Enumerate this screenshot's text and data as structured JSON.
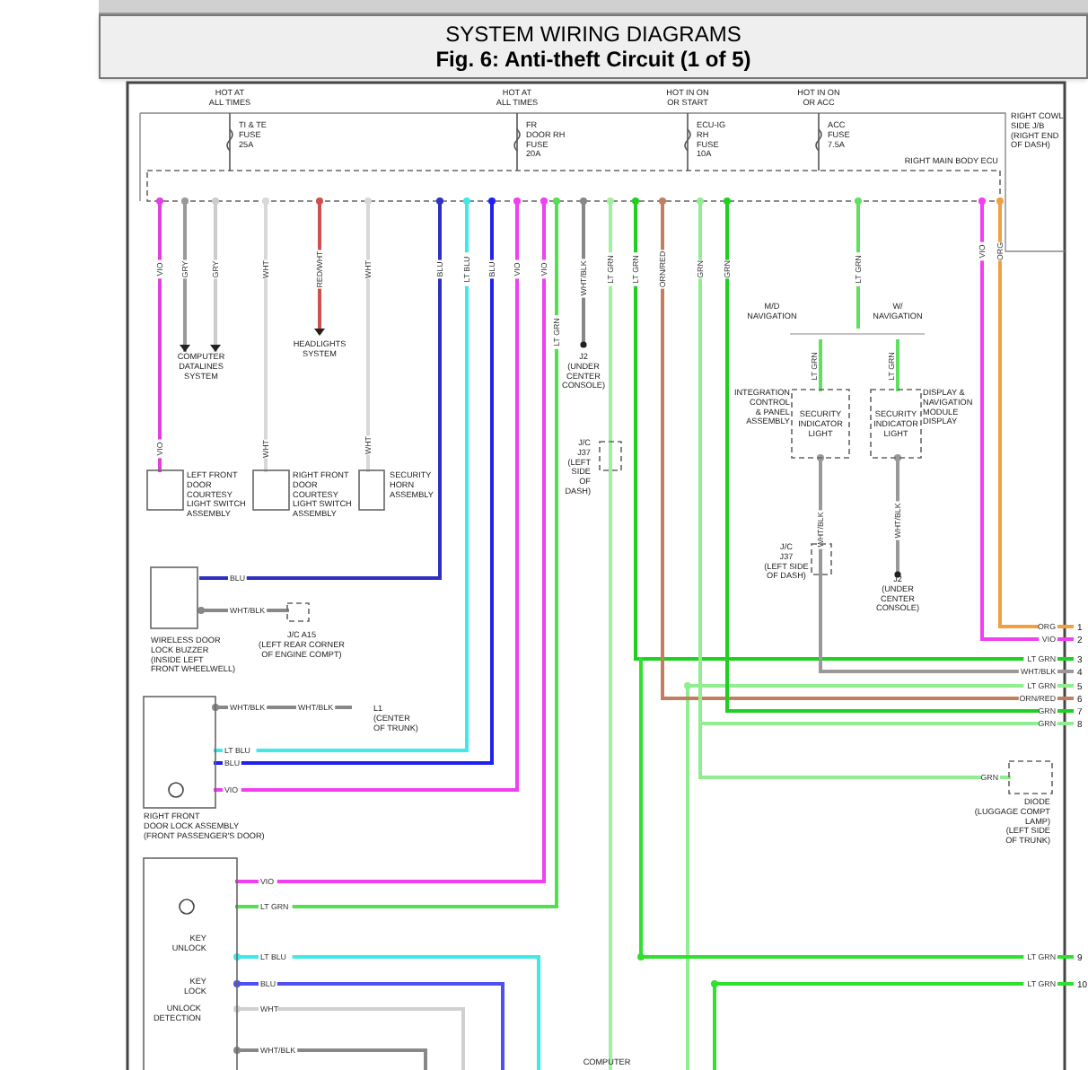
{
  "header": {
    "title": "SYSTEM WIRING DIAGRAMS",
    "figure": "Fig. 6: Anti-theft Circuit (1 of 5)"
  },
  "diagram": {
    "supplies": [
      {
        "label": [
          "HOT AT",
          "ALL TIMES"
        ],
        "fuse": [
          "TI & TE",
          "FUSE",
          "25A"
        ]
      },
      {
        "label": [
          "HOT AT",
          "ALL TIMES"
        ],
        "fuse": [
          "FR",
          "DOOR RH",
          "FUSE",
          "20A"
        ]
      },
      {
        "label": [
          "HOT IN ON",
          "OR START"
        ],
        "fuse": [
          "ECU-IG",
          "RH",
          "FUSE",
          "10A"
        ]
      },
      {
        "label": [
          "HOT IN ON",
          "OR ACC"
        ],
        "fuse": [
          "ACC",
          "FUSE",
          "7.5A"
        ]
      }
    ],
    "wires": [
      {
        "labels": [
          "VIO",
          "VIO"
        ],
        "color": "#e040e0"
      },
      {
        "labels": [
          "GRY"
        ],
        "color": "#999999"
      },
      {
        "labels": [
          "GRY"
        ],
        "color": "#cccccc"
      },
      {
        "labels": [
          "WHT",
          "WHT"
        ],
        "color": "#d8d8d8"
      },
      {
        "labels": [
          "RED/WHT"
        ],
        "color": "#d05050"
      },
      {
        "labels": [
          "WHT",
          "WHT"
        ],
        "color": "#d8d8d8"
      },
      {
        "labels": [
          "BLU",
          "BLU"
        ],
        "color": "#3030c0"
      },
      {
        "labels": [
          "LT BLU",
          "LT BLU"
        ],
        "color": "#40e8e8"
      },
      {
        "labels": [
          "BLU",
          "BLU"
        ],
        "color": "#2020f0"
      },
      {
        "labels": [
          "VIO",
          "VIO"
        ],
        "color": "#f040f0"
      },
      {
        "labels": [
          "VIO",
          "VIO"
        ],
        "color": "#f040f0"
      },
      {
        "labels": [
          "LT GRN",
          "LT GRN"
        ],
        "color": "#50e050"
      },
      {
        "labels": [
          "WHT/BLK"
        ],
        "color": "#888888"
      },
      {
        "labels": [
          "LT GRN"
        ],
        "color": "#a0f0a0"
      },
      {
        "labels": [
          "ORG",
          "ORG"
        ],
        "color": "#f0a040",
        "pin": "1"
      },
      {
        "labels": [
          "VIO",
          "VIO"
        ],
        "color": "#f040f0",
        "pin": "2"
      },
      {
        "labels": [
          "LT GRN",
          "LT GRN"
        ],
        "color": "#20d020",
        "pin": "3"
      },
      {
        "labels": [
          "WHT/BLK",
          "WHT/BLK"
        ],
        "color": "#999999",
        "pin": "4"
      },
      {
        "labels": [
          "LT GRN"
        ],
        "color": "#90ee90",
        "pin": "5"
      },
      {
        "labels": [
          "ORN/RED",
          "ORN/RED"
        ],
        "color": "#c08060",
        "pin": "6"
      },
      {
        "labels": [
          "GRN",
          "GRN"
        ],
        "color": "#20d020",
        "pin": "7"
      },
      {
        "labels": [
          "GRN",
          "GRN",
          "GRN"
        ],
        "color": "#90ee90",
        "pin": "8"
      },
      {
        "labels": [
          "LT GRN"
        ],
        "color": "#30e030",
        "pin": "9"
      },
      {
        "labels": [
          "LT GRN"
        ],
        "color": "#30e030",
        "pin": "10"
      },
      {
        "labels": [
          "LT GRN",
          "LT GRN",
          "LT GRN"
        ],
        "color": "#60e060"
      },
      {
        "labels": [
          "WHT/BLK"
        ],
        "color": "#999999"
      },
      {
        "labels": [
          "LT BLU"
        ],
        "color": "#40e8e8"
      },
      {
        "labels": [
          "BLU"
        ],
        "color": "#5050f0"
      },
      {
        "labels": [
          "WHT"
        ],
        "color": "#d0d0d0"
      },
      {
        "labels": [
          "WHT/BLK"
        ],
        "color": "#888888"
      },
      {
        "labels": [
          "WHT/BLK"
        ],
        "color": "#888888"
      },
      {
        "labels": [
          "WHT/BLK",
          "WHT/BLK"
        ],
        "color": "#888888"
      }
    ],
    "labels": [
      [
        "COMPUTER",
        "DATALINES",
        "SYSTEM"
      ],
      [
        "HEADLIGHTS",
        "SYSTEM"
      ],
      [
        "J2",
        "(UNDER",
        "CENTER",
        "CONSOLE)"
      ],
      [
        "J/C",
        "J37",
        "(LEFT",
        "SIDE",
        "OF",
        "DASH)"
      ],
      [
        "LEFT FRONT",
        "DOOR",
        "COURTESY",
        "LIGHT SWITCH",
        "ASSEMBLY"
      ],
      [
        "RIGHT FRONT",
        "DOOR",
        "COURTESY",
        "LIGHT SWITCH",
        "ASSEMBLY"
      ],
      [
        "SECURITY",
        "HORN",
        "ASSEMBLY"
      ],
      [
        "WIRELESS DOOR",
        "LOCK BUZZER",
        "(INSIDE LEFT",
        "FRONT WHEELWELL)"
      ],
      [
        "J/C A15",
        "(LEFT REAR CORNER",
        "OF ENGINE COMPT)"
      ],
      [
        "L1",
        "(CENTER",
        "OF TRUNK)"
      ],
      [
        "RIGHT FRONT",
        "DOOR LOCK ASSEMBLY",
        "(FRONT PASSENGER'S DOOR)"
      ],
      [
        "M/D",
        "NAVIGATION"
      ],
      [
        "W/",
        "NAVIGATION"
      ],
      [
        "INTEGRATION",
        "CONTROL",
        "& PANEL",
        "ASSEMBLY"
      ],
      [
        "SECURITY",
        "INDICATOR",
        "LIGHT"
      ],
      [
        "SECURITY",
        "INDICATOR",
        "LIGHT"
      ],
      [
        "DISPLAY &",
        "NAVIGATION",
        "MODULE",
        "DISPLAY"
      ],
      [
        "J/C",
        "J37",
        "(LEFT SIDE",
        "OF DASH)"
      ],
      [
        "J2",
        "(UNDER",
        "CENTER",
        "CONSOLE)"
      ],
      [
        "DIODE",
        "(LUGGAGE COMPT",
        "LAMP)",
        "(LEFT SIDE",
        "OF TRUNK)"
      ],
      [
        "KEY",
        "UNLOCK"
      ],
      [
        "KEY",
        "LOCK"
      ],
      [
        "UNLOCK",
        "DETECTION"
      ],
      [
        "COMPUTER"
      ],
      [
        "RIGHT COWL",
        "SIDE J/B",
        "(RIGHT END",
        "OF DASH)"
      ],
      [
        "RIGHT MAIN BODY ECU"
      ]
    ]
  }
}
